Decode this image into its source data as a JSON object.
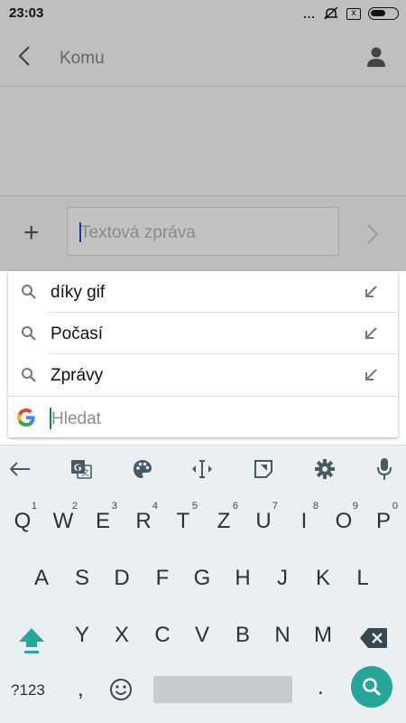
{
  "status_bar": {
    "time": "23:03",
    "dots": "...",
    "box_icon": "x"
  },
  "app_bar": {
    "title": "Komu",
    "back_icon": "chevron-left-icon",
    "contact_icon": "person-icon"
  },
  "compose": {
    "placeholder": "Textová zpráva",
    "attach_label": "+",
    "send_icon": "chevron-right-icon"
  },
  "suggestions": [
    {
      "text": "díky gif"
    },
    {
      "text": "Počasí"
    },
    {
      "text": "Zprávy"
    }
  ],
  "google_search": {
    "placeholder": "Hledat"
  },
  "keyboard": {
    "toolbar": [
      "back-arrow-icon",
      "translate-icon",
      "palette-icon",
      "cursor-move-icon",
      "sticker-icon",
      "gear-icon",
      "mic-icon"
    ],
    "row1": [
      {
        "label": "Q",
        "hint": "1"
      },
      {
        "label": "W",
        "hint": "2"
      },
      {
        "label": "E",
        "hint": "3"
      },
      {
        "label": "R",
        "hint": "4"
      },
      {
        "label": "T",
        "hint": "5"
      },
      {
        "label": "Z",
        "hint": "6"
      },
      {
        "label": "U",
        "hint": "7"
      },
      {
        "label": "I",
        "hint": "8"
      },
      {
        "label": "O",
        "hint": "9"
      },
      {
        "label": "P",
        "hint": "0"
      }
    ],
    "row2": [
      "A",
      "S",
      "D",
      "F",
      "G",
      "H",
      "J",
      "K",
      "L"
    ],
    "row3": [
      "Y",
      "X",
      "C",
      "V",
      "B",
      "N",
      "M"
    ],
    "symbols_label": "?123",
    "comma_label": ",",
    "period_label": ".",
    "accent_color": "#26a69a"
  }
}
